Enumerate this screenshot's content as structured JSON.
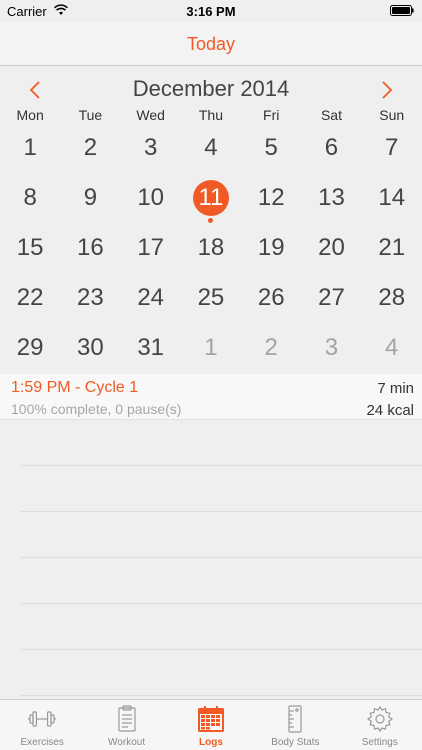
{
  "status_bar": {
    "carrier": "Carrier",
    "time": "3:16 PM"
  },
  "nav": {
    "title": "Today"
  },
  "calendar": {
    "month": "December 2014",
    "weekdays": [
      "Mon",
      "Tue",
      "Wed",
      "Thu",
      "Fri",
      "Sat",
      "Sun"
    ],
    "weeks": [
      [
        "1",
        "2",
        "3",
        "4",
        "5",
        "6",
        "7"
      ],
      [
        "8",
        "9",
        "10",
        "11",
        "12",
        "13",
        "14"
      ],
      [
        "15",
        "16",
        "17",
        "18",
        "19",
        "20",
        "21"
      ],
      [
        "22",
        "23",
        "24",
        "25",
        "26",
        "27",
        "28"
      ],
      [
        "29",
        "30",
        "31",
        "1",
        "2",
        "3",
        "4"
      ]
    ],
    "selected_day": "11"
  },
  "log": {
    "title": "1:59 PM - Cycle 1",
    "subtitle": "100% complete, 0 pause(s)",
    "duration": "7 min",
    "kcal": "24 kcal"
  },
  "tabs": [
    {
      "label": "Exercises",
      "icon": "dumbbell-icon"
    },
    {
      "label": "Workout",
      "icon": "clipboard-icon"
    },
    {
      "label": "Logs",
      "icon": "calendar-icon"
    },
    {
      "label": "Body Stats",
      "icon": "ruler-icon"
    },
    {
      "label": "Settings",
      "icon": "gear-icon"
    }
  ],
  "colors": {
    "accent": "#f15a24",
    "muted": "#a3a3a3"
  }
}
